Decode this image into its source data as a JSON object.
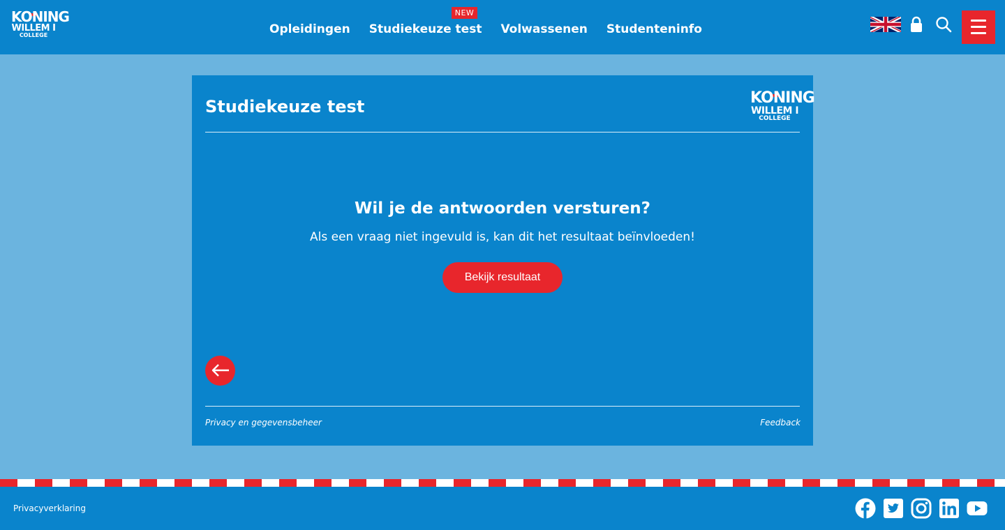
{
  "header": {
    "logo": {
      "line1": "KONING",
      "line2": "WILLEM I",
      "line3": "COLLEGE"
    },
    "nav": [
      {
        "label": "Opleidingen"
      },
      {
        "label": "Studiekeuze test",
        "badge": "NEW"
      },
      {
        "label": "Volwassenen"
      },
      {
        "label": "Studenteninfo"
      }
    ],
    "icons": [
      "uk-flag-icon",
      "lock-icon",
      "search-icon",
      "hamburger-menu-icon"
    ]
  },
  "card": {
    "title": "Studiekeuze test",
    "question": "Wil je de antwoorden versturen?",
    "subtext": "Als een vraag niet ingevuld is, kan dit het resultaat beïnvloeden!",
    "result_button": "Bekijk resultaat",
    "back_icon": "arrow-left-icon",
    "privacy_link": "Privacy en gegevensbeheer",
    "feedback_link": "Feedback"
  },
  "footer": {
    "privacy": "Privacyverklaring",
    "social": [
      "facebook-icon",
      "twitter-icon",
      "instagram-icon",
      "linkedin-icon",
      "youtube-icon"
    ]
  },
  "colors": {
    "primary": "#0a84cc",
    "background": "#6bb4df",
    "accent": "#e8262c"
  }
}
